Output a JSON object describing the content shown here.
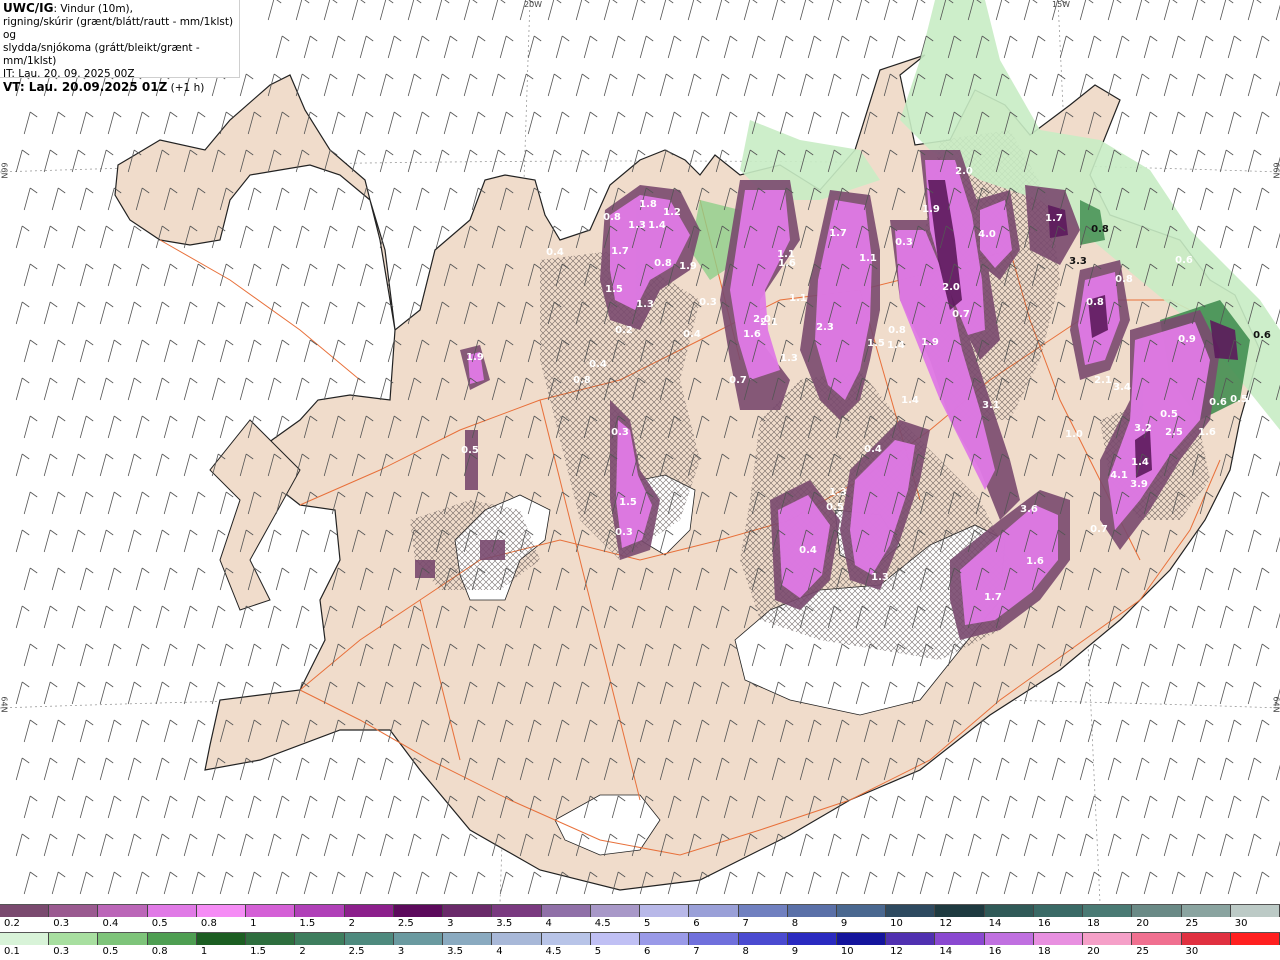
{
  "title": {
    "source": "UWC/IG",
    "line1": ": Vindur (10m),",
    "line2": "rigning/skúrir (grænt/blátt/rautt - mm/1klst) og",
    "line3": "slydda/snjókoma (grátt/bleikt/grænt - mm/1klst)",
    "it_prefix": "IT: Lau. 20. 09. 2025 00Z",
    "vt_prefix": "VT: Lau. 20.09.2025 01Z",
    "vt_suffix": " (+1 h)"
  },
  "graticule": {
    "lon_labels": [
      "20W",
      "15W"
    ],
    "lat_left": [
      "66N",
      "64N"
    ],
    "lat_right": [
      "66N",
      "64N"
    ]
  },
  "map_values": [
    "1.8",
    "1.2",
    "0.8",
    "1.3",
    "1.4",
    "1.7",
    "0.8",
    "1.9",
    "1.5",
    "1.3",
    "0.2",
    "0.3",
    "0.4",
    "1.9",
    "0.8",
    "0.4",
    "0.5",
    "0.3",
    "1.5",
    "0.3",
    "0.4",
    "0.4",
    "1.3",
    "1.1",
    "1.6",
    "2.1",
    "1.1",
    "0.7",
    "1.7",
    "2.3",
    "2.0",
    "1.6",
    "1.1",
    "0.8",
    "1.5",
    "1.4",
    "1.9",
    "1.4",
    "0.4",
    "1.3",
    "1.3",
    "0.5",
    "1.9",
    "0.3",
    "4.0",
    "2.0",
    "2.0",
    "0.7",
    "3.1",
    "3.6",
    "1.6",
    "1.7",
    "1.7",
    "0.8",
    "3.3",
    "0.8",
    "0.8",
    "2.1",
    "3.4",
    "1.0",
    "0.9",
    "0.5",
    "3.2",
    "1.4",
    "3.9",
    "4.1",
    "2.5",
    "1.6",
    "0.6",
    "0.6",
    "0.5",
    "0.6",
    "0.7"
  ],
  "snow_scale": {
    "labels": [
      "0.2",
      "0.3",
      "0.4",
      "0.5",
      "0.8",
      "1",
      "1.5",
      "2",
      "2.5",
      "3",
      "3.5",
      "4",
      "4.5",
      "5",
      "6",
      "7",
      "8",
      "9",
      "10",
      "12",
      "14",
      "16",
      "18",
      "20",
      "25",
      "30"
    ],
    "colors": [
      "#7a4a6f",
      "#9a5a90",
      "#bb66b8",
      "#e07ae6",
      "#f58cf5",
      "#d460d6",
      "#b040b8",
      "#8c1f8c",
      "#5c0a5c",
      "#6a2a6a",
      "#7a3a80",
      "#9070a8",
      "#a898c8",
      "#b8b8e8",
      "#9aa0d8",
      "#7080c0",
      "#5a70a8",
      "#4a6890",
      "#2e4a60",
      "#1e3a40",
      "#305a58",
      "#3a6a66",
      "#4a7a74",
      "#6a8a86",
      "#8aa4a0",
      "#bccac6"
    ]
  },
  "rain_scale": {
    "labels": [
      "0.1",
      "0.3",
      "0.5",
      "0.8",
      "1",
      "1.5",
      "2",
      "2.5",
      "3",
      "3.5",
      "4",
      "4.5",
      "5",
      "6",
      "7",
      "8",
      "9",
      "10",
      "12",
      "14",
      "16",
      "18",
      "20",
      "25",
      "30"
    ],
    "colors": [
      "#d8f3d8",
      "#a8dfa0",
      "#7ec47a",
      "#4e9e52",
      "#1c5e22",
      "#2e6e3e",
      "#3e7e5e",
      "#4e8a7e",
      "#6a9aa0",
      "#8aaac0",
      "#a8b8d8",
      "#b8c4e8",
      "#c0c0f4",
      "#9a9ae8",
      "#7070dc",
      "#4a4ad0",
      "#2a2ac0",
      "#14149c",
      "#5030b0",
      "#8a48d0",
      "#c070e0",
      "#e890e0",
      "#f5a0c8",
      "#f07090",
      "#e03040",
      "#ff2020"
    ]
  }
}
